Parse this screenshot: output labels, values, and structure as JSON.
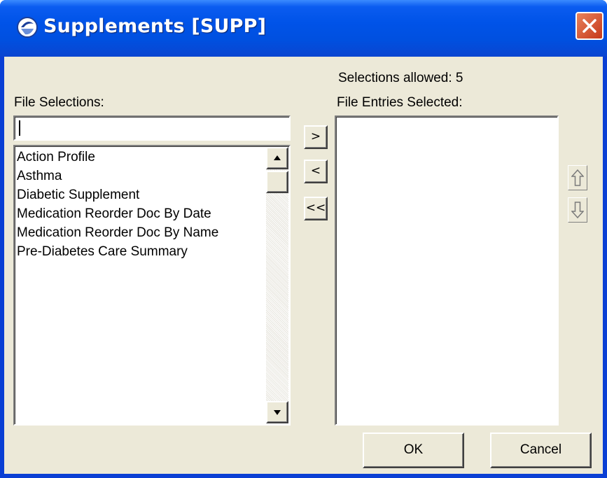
{
  "window": {
    "title": "Supplements [SUPP]"
  },
  "labels": {
    "selections_allowed": "Selections allowed:  5",
    "file_selections": "File Selections:",
    "file_entries_selected": "File Entries Selected:"
  },
  "search": {
    "value": ""
  },
  "file_selections": [
    "Action Profile",
    "Asthma",
    "Diabetic Supplement",
    "Medication Reorder Doc By Date",
    "Medication Reorder Doc By Name",
    "Pre-Diabetes Care Summary"
  ],
  "file_entries_selected": [],
  "move_buttons": {
    "add": ">",
    "remove": "<",
    "remove_all": "<<"
  },
  "order_buttons": {
    "up_icon": "arrow-up-outline-icon",
    "down_icon": "arrow-down-outline-icon"
  },
  "footer": {
    "ok": "OK",
    "cancel": "Cancel"
  },
  "colors": {
    "title_bar": "#0053e8",
    "client": "#ece9d8",
    "close": "#d9532f"
  }
}
